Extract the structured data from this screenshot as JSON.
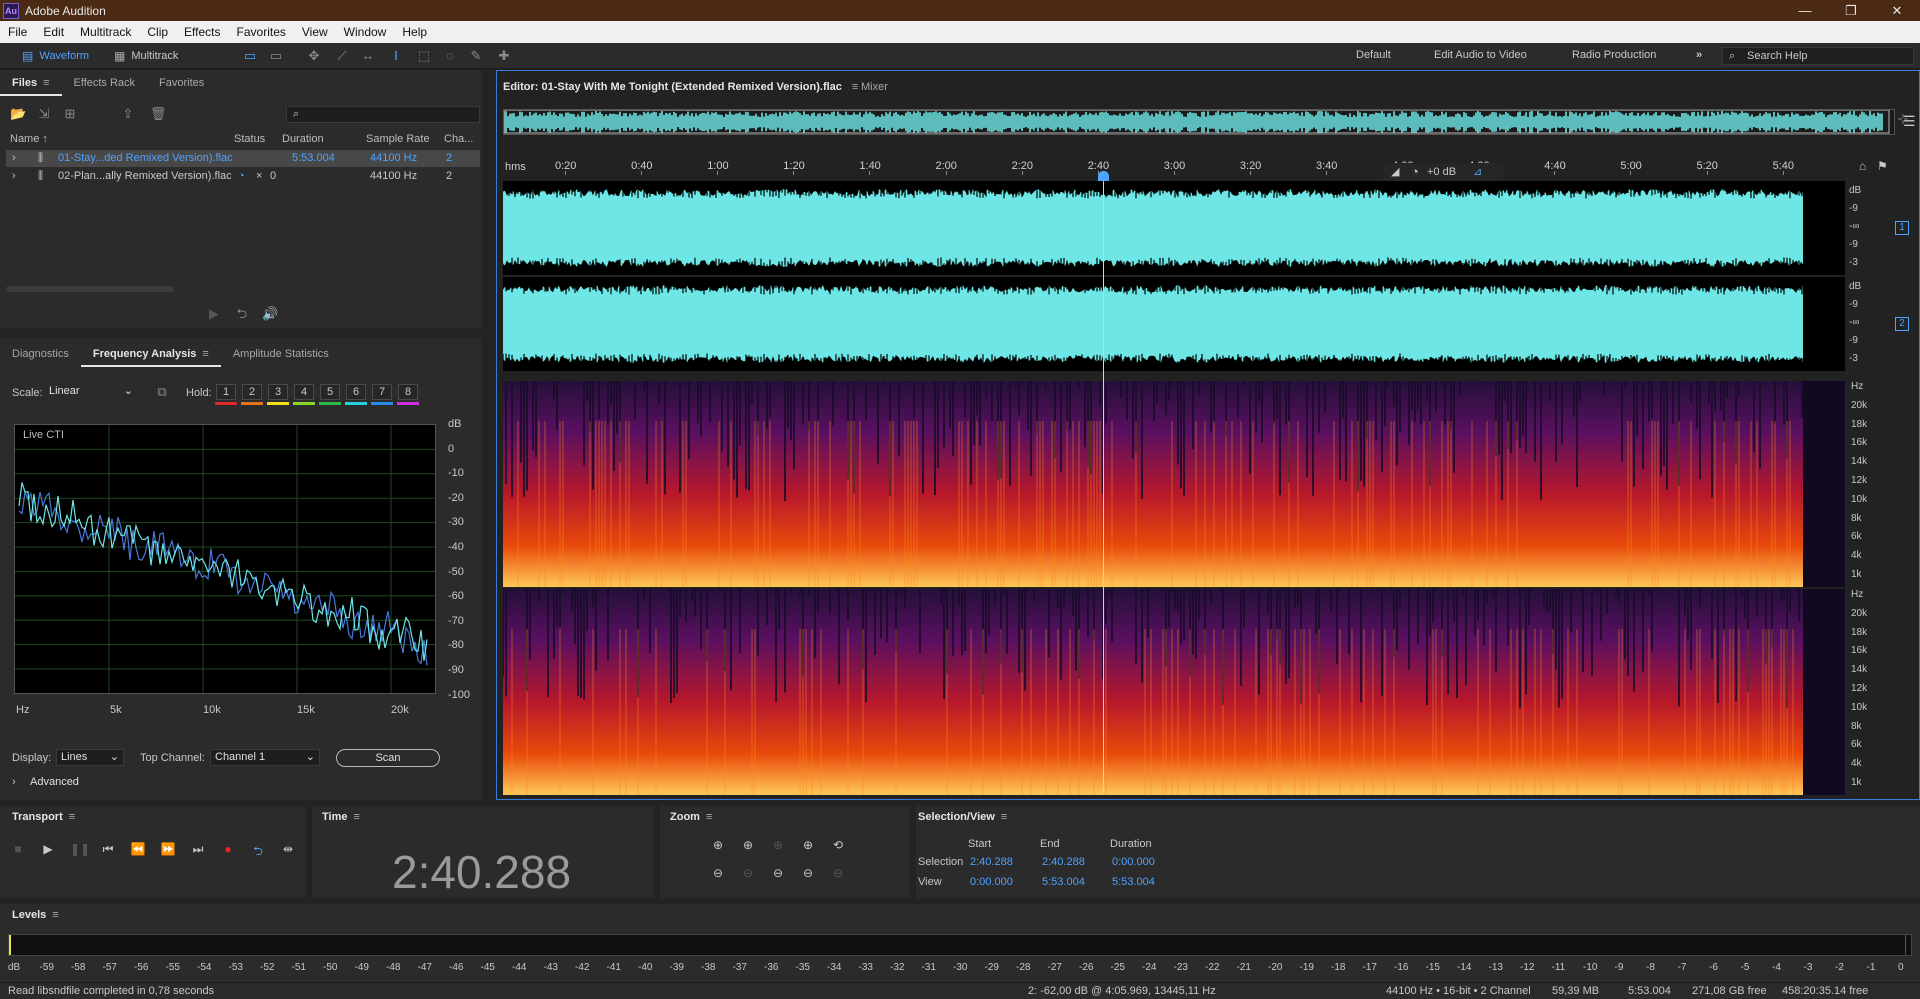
{
  "app": {
    "title": "Adobe Audition",
    "logo": "Au"
  },
  "menu": [
    "File",
    "Edit",
    "Multitrack",
    "Clip",
    "Effects",
    "Favorites",
    "View",
    "Window",
    "Help"
  ],
  "toolbar": {
    "waveform": "Waveform",
    "multitrack": "Multitrack",
    "workspaces": [
      "Default",
      "Edit Audio to Video",
      "Radio Production"
    ],
    "search_placeholder": "Search Help"
  },
  "files_panel": {
    "tabs": [
      "Files",
      "Effects Rack",
      "Favorites"
    ],
    "search_icon": "search-icon",
    "columns": {
      "name": "Name ↑",
      "status": "Status",
      "duration": "Duration",
      "sample_rate": "Sample Rate",
      "channels": "Cha..."
    },
    "rows": [
      {
        "name": "01-Stay...ded Remixed Version).flac",
        "status": "",
        "duration": "5:53.004",
        "sample_rate": "44100 Hz",
        "channels": "2"
      },
      {
        "name": "02-Plan...ally Remixed Version).flac",
        "status": "0",
        "duration": "",
        "sample_rate": "44100 Hz",
        "channels": "2"
      }
    ]
  },
  "freq_panel": {
    "tabs": [
      "Diagnostics",
      "Frequency Analysis",
      "Amplitude Statistics"
    ],
    "scale_label": "Scale:",
    "scale_value": "Linear",
    "hold_label": "Hold:",
    "holds": [
      "1",
      "2",
      "3",
      "4",
      "5",
      "6",
      "7",
      "8"
    ],
    "hold_colors": [
      "#e02828",
      "#e8741a",
      "#f0e020",
      "#8cd62a",
      "#2ab84a",
      "#22d0e0",
      "#2a8ce8",
      "#d030e0"
    ],
    "graph_label": "Live CTI",
    "db_labels": [
      "dB",
      "0",
      "-10",
      "-20",
      "-30",
      "-40",
      "-50",
      "-60",
      "-70",
      "-80",
      "-90",
      "-100"
    ],
    "hz_labels": [
      "Hz",
      "5k",
      "10k",
      "15k",
      "20k"
    ],
    "display_label": "Display:",
    "display_value": "Lines",
    "top_channel_label": "Top Channel:",
    "top_channel_value": "Channel 1",
    "scan": "Scan",
    "advanced": "Advanced"
  },
  "editor": {
    "tab_title": "Editor: 01-Stay With Me Tonight (Extended Remixed Version).flac",
    "mixer": "Mixer",
    "ruler_unit": "hms",
    "ruler": [
      "0:20",
      "0:40",
      "1:00",
      "1:20",
      "1:40",
      "2:00",
      "2:20",
      "2:40",
      "3:00",
      "3:20",
      "3:40",
      "4:00",
      "4:20",
      "4:40",
      "5:00",
      "5:20",
      "5:40"
    ],
    "gain": "+0 dB",
    "wave_db": [
      "dB",
      "-9",
      "-∞",
      "-9",
      "-3"
    ],
    "channel_badges": [
      "1",
      "2"
    ],
    "spec_hz": [
      "Hz",
      "20k",
      "18k",
      "16k",
      "14k",
      "12k",
      "10k",
      "8k",
      "6k",
      "4k",
      "1k"
    ]
  },
  "transport": {
    "title": "Transport"
  },
  "time": {
    "title": "Time",
    "value": "2:40.288"
  },
  "zoom": {
    "title": "Zoom"
  },
  "selection": {
    "title": "Selection/View",
    "cols": [
      "Start",
      "End",
      "Duration"
    ],
    "rows": [
      {
        "label": "Selection",
        "start": "2:40.288",
        "end": "2:40.288",
        "duration": "0:00.000"
      },
      {
        "label": "View",
        "start": "0:00.000",
        "end": "5:53.004",
        "duration": "5:53.004"
      }
    ]
  },
  "levels": {
    "title": "Levels",
    "scale": [
      "dB",
      "-59",
      "-58",
      "-57",
      "-56",
      "-55",
      "-54",
      "-53",
      "-52",
      "-51",
      "-50",
      "-49",
      "-48",
      "-47",
      "-46",
      "-45",
      "-44",
      "-43",
      "-42",
      "-41",
      "-40",
      "-39",
      "-38",
      "-37",
      "-36",
      "-35",
      "-34",
      "-33",
      "-32",
      "-31",
      "-30",
      "-29",
      "-28",
      "-27",
      "-26",
      "-25",
      "-24",
      "-23",
      "-22",
      "-21",
      "-20",
      "-19",
      "-18",
      "-17",
      "-16",
      "-15",
      "-14",
      "-13",
      "-12",
      "-11",
      "-10",
      "-9",
      "-8",
      "-7",
      "-6",
      "-5",
      "-4",
      "-3",
      "-2",
      "-1",
      "0"
    ]
  },
  "status": {
    "message": "Read libsndfile completed in 0,78 seconds",
    "cursor": "2: -62,00 dB @ 4:05.969, 13445,11 Hz",
    "format": "44100 Hz • 16-bit • 2 Channel",
    "size": "59,39 MB",
    "duration": "5:53.004",
    "free": "271,08 GB free",
    "time_free": "458:20:35.14 free"
  },
  "colors": {
    "accent": "#4fa3ff",
    "waveform": "#6ee6e6",
    "playhead": "#e6e640"
  }
}
